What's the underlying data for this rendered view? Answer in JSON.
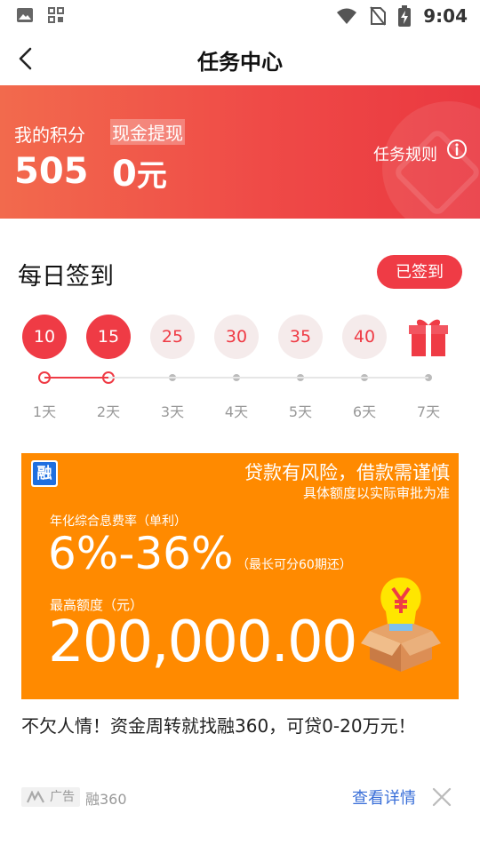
{
  "status_bar": {
    "time": "9:04"
  },
  "header": {
    "title": "任务中心"
  },
  "banner": {
    "points_label": "我的积分",
    "cash_label": "现金提现",
    "points_value": "505",
    "cash_value": "0",
    "cash_unit": "元",
    "rules_label": "任务规则"
  },
  "sign_in": {
    "title": "每日签到",
    "status_button": "已签到",
    "signed_days": 2,
    "rewards": [
      "10",
      "15",
      "25",
      "30",
      "35",
      "40"
    ],
    "days": [
      "1天",
      "2天",
      "3天",
      "4天",
      "5天",
      "6天",
      "7天"
    ]
  },
  "ad": {
    "logo_char": "融",
    "risk_text": "贷款有风险，借款需谨慎",
    "risk_sub": "具体额度以实际审批为准",
    "rate_label": "年化综合息费率（单利）",
    "rate_value": "6%-36%",
    "rate_note": "（最长可分60期还）",
    "limit_label": "最高额度（元）",
    "limit_value": "200,000.00",
    "caption": "不欠人情！资金周转就找融360，可贷0-20万元！",
    "tag_label": "广告",
    "source": "融360",
    "detail_link": "查看详情"
  },
  "colors": {
    "accent": "#ef3b45",
    "ad_bg": "#ff8a00",
    "link": "#3a6fd8"
  }
}
